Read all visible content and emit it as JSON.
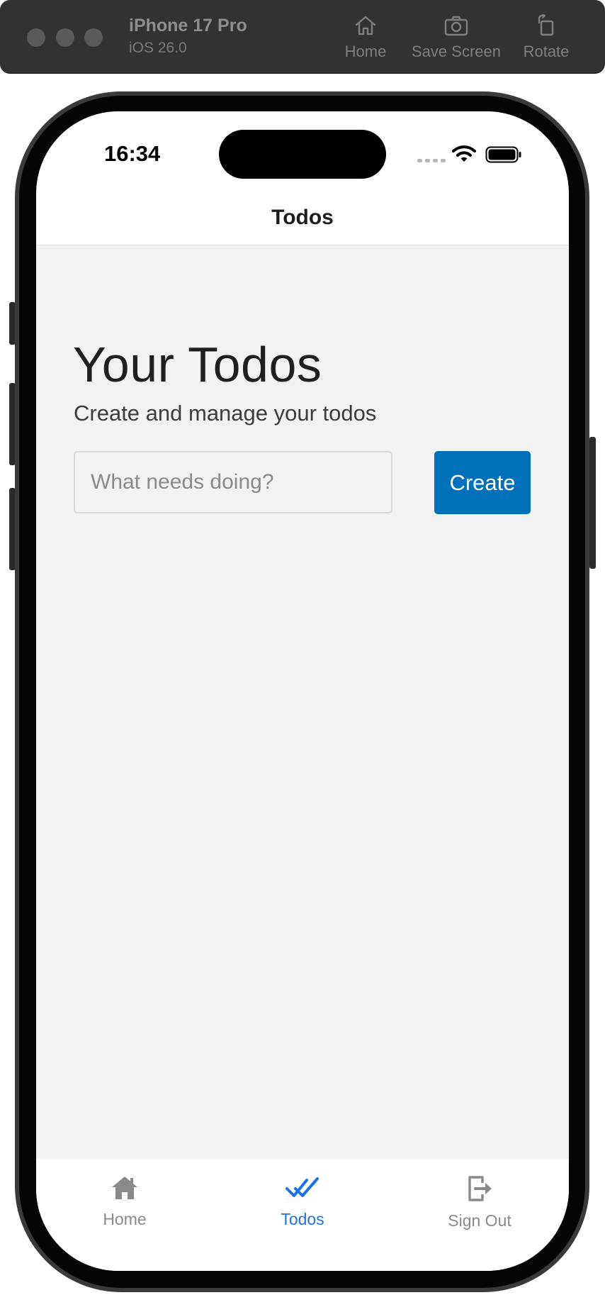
{
  "simulator": {
    "device_name": "iPhone 17 Pro",
    "os_version": "iOS 26.0",
    "tools": [
      {
        "label": "Home",
        "icon": "home-outline-icon"
      },
      {
        "label": "Save Screen",
        "icon": "camera-icon"
      },
      {
        "label": "Rotate",
        "icon": "rotate-icon"
      }
    ]
  },
  "status_bar": {
    "time": "16:34"
  },
  "nav": {
    "title": "Todos"
  },
  "page": {
    "title": "Your Todos",
    "subtitle": "Create and manage your todos",
    "input": {
      "placeholder": "What needs doing?",
      "value": ""
    },
    "create_label": "Create"
  },
  "tabbar": {
    "items": [
      {
        "label": "Home",
        "icon": "house-icon",
        "active": false
      },
      {
        "label": "Todos",
        "icon": "double-check-icon",
        "active": true
      },
      {
        "label": "Sign Out",
        "icon": "sign-out-icon",
        "active": false
      }
    ]
  },
  "colors": {
    "accent": "#1a73e8",
    "button": "#0071b9",
    "content_bg": "#f2f2f2",
    "inactive_tab": "#8a8a8a"
  }
}
